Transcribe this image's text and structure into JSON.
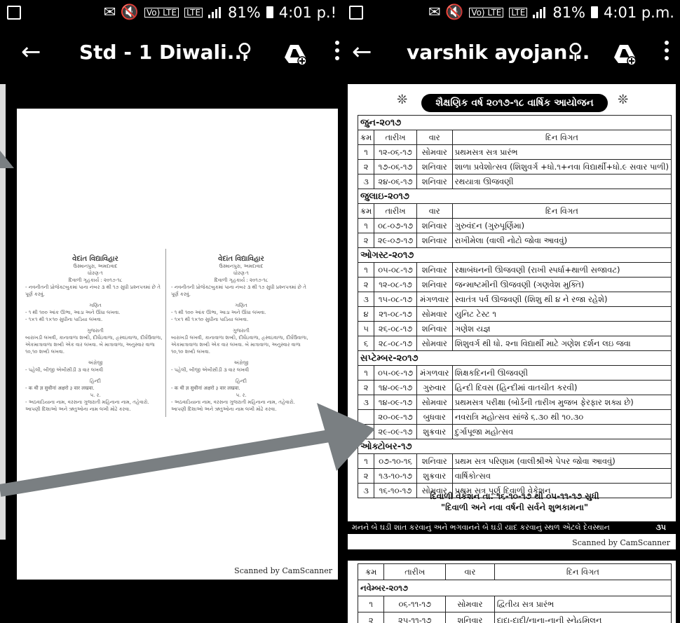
{
  "left": {
    "status": {
      "icons": "✉ 🔇",
      "volte": "Vo) LTE",
      "lte": "LTE",
      "battery": "81%",
      "time": "4:01 p.!"
    },
    "appbar": {
      "title": "Std - 1 Diwali..."
    },
    "doc": {
      "school": "વેદાંત વિદ્યાવિહાર",
      "address": "ઉસ્માનપુરા, અમદાવાદ",
      "std": "ધોરણ-૧",
      "hw_title": "દિવાળી ગૃહકાર્ય : ૨૦૧૭-૧૮",
      "intro": "- નવનીતની પ્રોજેક્ટબુકમાં પાના નંબર ૩ થી ૧૭ સુધી પ્રશ્નપત્રમાં છે તે પૂર્ણ કરવું.",
      "math_h": "ગણિત",
      "math_1": "- ૧ થી ૧૦૦ આંક ઊભા, આડા અને ઊંધા લખવા.",
      "math_2": "- ૧×૧ થી ૧×૧૦ સુધીના પાડિયા લખવા.",
      "guj_h": "ગુજરાતી",
      "guj_1": "બારાખડી લખવી, કાનાવાળા શબ્દો, દીર્ઘઇવાળા, હ્રસ્વઇવાળા, દીર્ઘઉવાળા, એકમાત્રાવાળા શબ્દો એક વાર લખવા. બે માત્રાવાળા, અનુસ્વાર વાળા ૧૦,૧૦ શબ્દો લખવા.",
      "eng_h": "અંગ્રેજી",
      "eng_1": "- પહેલી, બીજી એબીસીડી ૩ વાર લખવી",
      "hindi_h": "હિન્દી",
      "hindi_1": "- क थी ज्ञ सुधीनां अक्षरो ३ वार लखवा.",
      "ev_h": "પ. ર.",
      "ev_1": "- અઠવાડિયાના નામ, વરસના ગુજરાતી મહિનાના નામ, તહેવારો. આપણી દિશાઓ અને ઋતુઓના નામ લખી મોઢે કરવા.",
      "scan": "Scanned by CamScanner"
    }
  },
  "right": {
    "status": {
      "icons": "✉ 🔇",
      "volte": "Vo) LTE",
      "lte": "LTE",
      "battery": "81%",
      "time": "4:01 p.m."
    },
    "appbar": {
      "title": "varshik ayojan..."
    },
    "doc": {
      "banner": "શૈક્ષણિક વર્ષ ૨૦૧૭-૧૮ વાર્ષિક આયોજન",
      "headers": [
        "ક્રમ",
        "તારીખ",
        "વાર",
        "દિન વિગત"
      ],
      "june": "જુન-૨૦૧૭",
      "june_rows": [
        [
          "૧",
          "૧૨-૦૬-૧૭",
          "સોમવાર",
          "પ્રથમસત્ર સત્ર પ્રારંભ"
        ],
        [
          "૨",
          "૧૭-૦૬-૧૭",
          "શનિવાર",
          "શાળા પ્રવેશોત્સવ (શિશુવર્ગ +ધો.૧+નવા વિદ્યાર્થી+ધો.૯ સવાર પાળી)"
        ],
        [
          "૩",
          "૨૪-૦૬-૧૭",
          "શનિવાર",
          "રથયાત્રા ઊજવણી"
        ]
      ],
      "july": "જુલાઇ-૨૦૧૭",
      "july_rows": [
        [
          "૧",
          "૦૮-૦૭-૧૭",
          "શનિવાર",
          "ગુરુવંદન (ગુરુપૂર્ણિમા)"
        ],
        [
          "૨",
          "૨૯-૦૭-૧૭",
          "શનિવાર",
          "રાખીમેલા (વાલી નોટો જોવા આવવું)"
        ]
      ],
      "aug": "ઓગસ્ટ-૨૦૧૭",
      "aug_rows": [
        [
          "૧",
          "૦૫-૦૮-૧૭",
          "શનિવાર",
          "રક્ષાબંધનની ઊજવણી (રાખી સ્પર્ધા+થાળી સજાવટ)"
        ],
        [
          "૨",
          "૧૨-૦૮-૧૭",
          "શનિવાર",
          "જન્માષ્ટમીની ઊજવણી (ગણવેશ મુક્તિ)"
        ],
        [
          "૩",
          "૧૫-૦૮-૧૭",
          "મંગળવાર",
          "સ્વાતંત્ર પર્વ ઊજવણી (શિશુ થી ૪ ને રજા રહેશે)"
        ],
        [
          "૪",
          "૨૧-૦૮-૧૭",
          "સોમવાર",
          "યુનિટ ટેસ્ટ ૧"
        ],
        [
          "૫",
          "૨૬-૦૮-૧૭",
          "શનિવાર",
          "ગણેશ યજ્ઞ"
        ],
        [
          "૬",
          "૨૮-૦૮-૧૭",
          "સોમવાર",
          "શિશુવર્ગ થી ધો. ૨ના વિદ્યાર્થી માટે ગણેશ દર્શન લઇ જવા"
        ]
      ],
      "sep": "સપ્ટેમ્બર-૨૦૧૭",
      "sep_rows": [
        [
          "૧",
          "૦૫-૦૯-૧૭",
          "મંગળવાર",
          "શિક્ષકદિનની ઊજવણી"
        ],
        [
          "૨",
          "૧૪-૦૯-૧૭",
          "ગુરુવાર",
          "હિન્દી દિવસ (હિન્દીમાં વાતચીત કરવી)"
        ],
        [
          "૩",
          "૧૪-૦૯-૧૭",
          "સોમવાર",
          "પ્રથમસત્ર પરીક્ષા (બોર્ડની તારીખ મુજબ ફેરફાર શક્ય છે)"
        ],
        [
          "",
          "૨૦-૦૯-૧૭",
          "બુધવાર",
          "નવરાત્રિ મહોત્સવ સાંજે ૬.૩૦ થી ૧૦.૩૦"
        ],
        [
          "",
          "૨૯-૦૯-૧૭",
          "શુક્રવાર",
          "દુર્ગાપૂજા મહોત્સવ"
        ]
      ],
      "oct": "ઓક્ટોબર-૧૭",
      "oct_rows": [
        [
          "૧",
          "૦૭-૧૦-૧૬",
          "શનિવાર",
          "પ્રથમ સત્ર પરિણામ (વાલીશ્રીએ પેપર જોવા આવવું)"
        ],
        [
          "૨",
          "૧૩-૧૦-૧૭",
          "શુક્રવાર",
          "વાર્ષિકોત્સવ"
        ],
        [
          "૩",
          "૧૬-૧૦-૧૭",
          "સોમવાર",
          "પ્રથમ સત્ર પૂર્ણ દિવાળી વેકેશન"
        ]
      ],
      "vacation": "દિવાળી વેકેશન તા. ૧૬-૧૦-૧૭ થી ૦૫-૧૧-૧૭ સુધી",
      "wish": "\"દિવાળી અને નવા વર્ષની સર્વને શુભકામના\"",
      "footer": "મનને બે ઘડી શાંત કરવાનું અને ભગવાનને બે ઘડી યાદ કરવાનું સ્થળ એટલે દેવસ્થાન",
      "page_no": "૩૫",
      "scan": "Scanned by CamScanner",
      "nov": "નવેમ્બર-૨૦૧૭",
      "nov_rows": [
        [
          "૧",
          "૦૬-૧૧-૧૭",
          "સોમવાર",
          "દ્વિતીય સત્ર પ્રારંભ"
        ],
        [
          "૨",
          "૨૫-૧૧-૧૭",
          "શનિવાર",
          "દાદા-દાદી/નાના-નાની સ્નેહમિલન"
        ]
      ]
    }
  },
  "arrow_color": "#7a7f82"
}
